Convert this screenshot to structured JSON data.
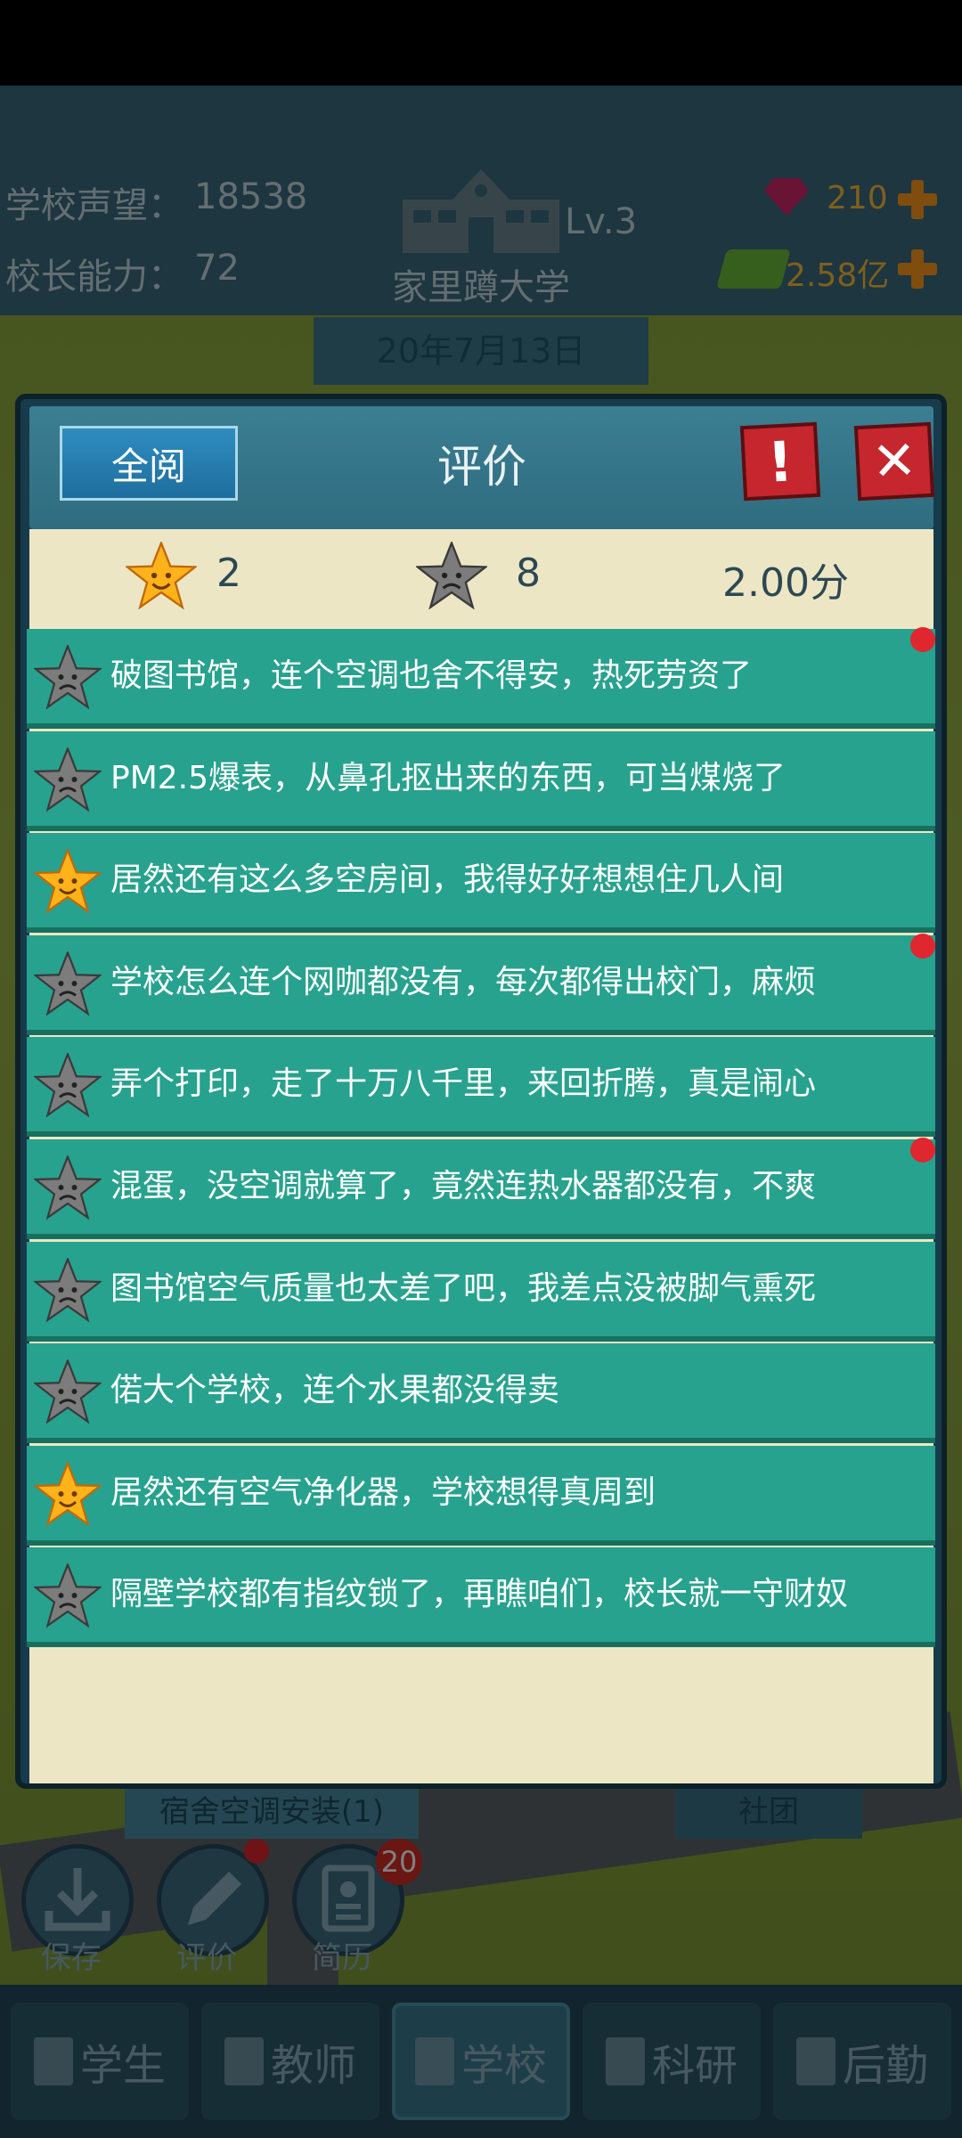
{
  "hud": {
    "reputation_label": "学校声望：",
    "reputation_value": "18538",
    "ability_label": "校长能力：",
    "ability_value": "72",
    "school_name": "家里蹲大学",
    "level": "Lv.3",
    "gems": "210",
    "money": "2.58亿",
    "date": "20年7月13日"
  },
  "bottom_buttons": {
    "save": "保存",
    "review": "评价",
    "resume": "简历",
    "resume_badge": "20"
  },
  "background_labels": {
    "left_sign": "宿舍空调安装(1)",
    "right_sign": "社团"
  },
  "nav": {
    "tabs": [
      {
        "label": "学生",
        "active": false
      },
      {
        "label": "教师",
        "active": false
      },
      {
        "label": "学校",
        "active": true
      },
      {
        "label": "科研",
        "active": false
      },
      {
        "label": "后勤",
        "active": false
      }
    ]
  },
  "dialog": {
    "read_all": "全阅",
    "title": "评价",
    "alert_icon": "!",
    "close_icon": "✕",
    "good_count": "2",
    "bad_count": "8",
    "score": "2.00分"
  },
  "reviews": [
    {
      "text": "破图书馆，连个空调也舍不得安，热死劳资了",
      "rating": "bad",
      "unread": true
    },
    {
      "text": "PM2.5爆表，从鼻孔抠出来的东西，可当煤烧了",
      "rating": "bad",
      "unread": false
    },
    {
      "text": "居然还有这么多空房间，我得好好想想住几人间",
      "rating": "good",
      "unread": false
    },
    {
      "text": "学校怎么连个网咖都没有，每次都得出校门，麻烦",
      "rating": "bad",
      "unread": true
    },
    {
      "text": "弄个打印，走了十万八千里，来回折腾，真是闹心",
      "rating": "bad",
      "unread": false
    },
    {
      "text": "混蛋，没空调就算了，竟然连热水器都没有，不爽",
      "rating": "bad",
      "unread": true
    },
    {
      "text": "图书馆空气质量也太差了吧，我差点没被脚气熏死",
      "rating": "bad",
      "unread": false
    },
    {
      "text": "偌大个学校，连个水果都没得卖",
      "rating": "bad",
      "unread": false
    },
    {
      "text": "居然还有空气净化器，学校想得真周到",
      "rating": "good",
      "unread": false
    },
    {
      "text": "隔壁学校都有指纹锁了，再瞧咱们，校长就一守财奴",
      "rating": "bad",
      "unread": false
    }
  ],
  "colors": {
    "row_bg": "#27a28e",
    "panel_bg": "#ede6c4",
    "good_star": "#ffb21a",
    "bad_star": "#7c7c7c",
    "close_red": "#c6262e"
  }
}
